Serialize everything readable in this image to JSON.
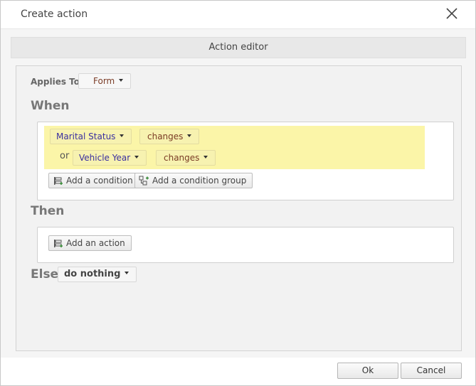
{
  "dialog": {
    "title": "Create action"
  },
  "section": {
    "header": "Action editor"
  },
  "applies_to": {
    "label": "Applies To",
    "value": "Form"
  },
  "when": {
    "heading": "When",
    "conditions": [
      {
        "connector": "",
        "field": "Marital Status",
        "operator": "changes"
      },
      {
        "connector": "or",
        "field": "Vehicle Year",
        "operator": "changes"
      }
    ],
    "add_condition_label": "Add a condition",
    "add_condition_group_label": "Add a condition group"
  },
  "then": {
    "heading": "Then",
    "add_action_label": "Add an action"
  },
  "else": {
    "heading": "Else",
    "value": "do nothing"
  },
  "footer": {
    "ok_label": "Ok",
    "cancel_label": "Cancel"
  },
  "colors": {
    "highlight": "#fbf5a8",
    "field_text": "#3a2fa0",
    "operator_text": "#7a3b25"
  }
}
